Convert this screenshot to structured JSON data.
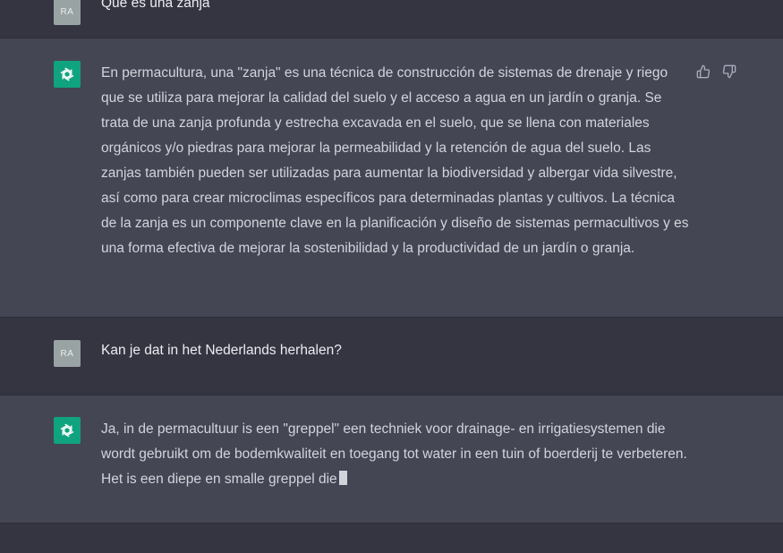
{
  "conversation": [
    {
      "role": "user",
      "avatar": "RA",
      "text": "Qué es una zanja"
    },
    {
      "role": "assistant",
      "avatar_icon": "openai-logo-icon",
      "text": "En permacultura, una \"zanja\" es una técnica de construcción de sistemas de drenaje y riego que se utiliza para mejorar la calidad del suelo y el acceso a agua en un jardín o granja. Se trata de una zanja profunda y estrecha excavada en el suelo, que se llena con materiales orgánicos y/o piedras para mejorar la permeabilidad y la retención de agua del suelo. Las zanjas también pueden ser utilizadas para aumentar la biodiversidad y albergar vida silvestre, así como para crear microclimas específicos para determinadas plantas y cultivos. La técnica de la zanja es un componente clave en la planificación y diseño de sistemas permacultivos y es una forma efectiva de mejorar la sostenibilidad y la productividad de un jardín o granja.",
      "feedback_icons": [
        "thumbs-up-icon",
        "thumbs-down-icon"
      ]
    },
    {
      "role": "user",
      "avatar": "RA",
      "text": "Kan je dat in het Nederlands herhalen?"
    },
    {
      "role": "assistant",
      "avatar_icon": "openai-logo-icon",
      "text": "Ja, in de permacultuur is een \"greppel\" een techniek voor drainage- en irrigatiesystemen die wordt gebruikt om de bodemkwaliteit en toegang tot water in een tuin of boerderij te verbeteren. Het is een diepe en smalle greppel die"
    }
  ],
  "colors": {
    "user_bg": "#343541",
    "assistant_bg": "#444654",
    "accent": "#10a37f",
    "text": "#d1d5db"
  }
}
